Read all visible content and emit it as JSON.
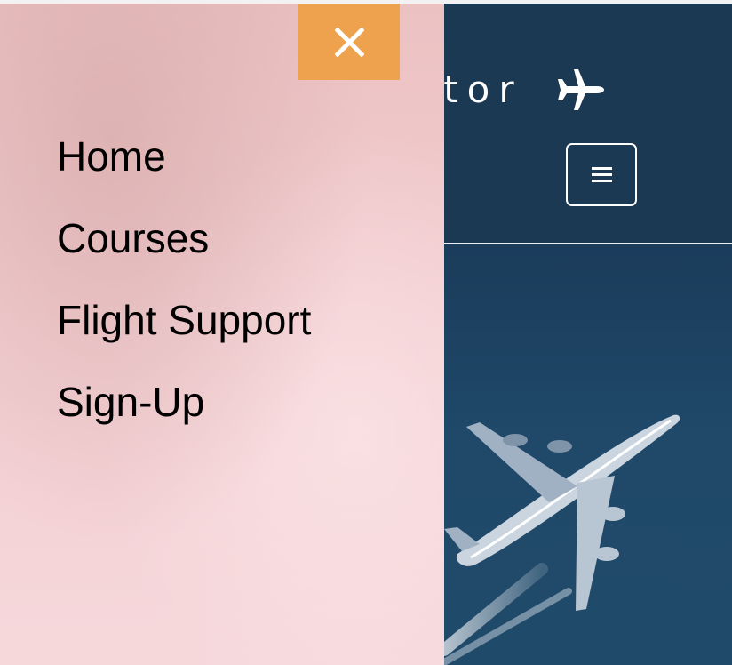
{
  "header": {
    "brand_text": "ator",
    "brand_icon": "plane-icon",
    "menu_toggle_icon": "hamburger-icon"
  },
  "drawer": {
    "close_icon": "close-icon",
    "nav_items": [
      {
        "label": "Home"
      },
      {
        "label": "Courses"
      },
      {
        "label": "Flight Support"
      },
      {
        "label": "Sign-Up"
      }
    ]
  },
  "colors": {
    "header_bg": "#1c3953",
    "drawer_bg": "#f2cdd0",
    "close_button": "#eea24e",
    "nav_text": "#000000"
  }
}
